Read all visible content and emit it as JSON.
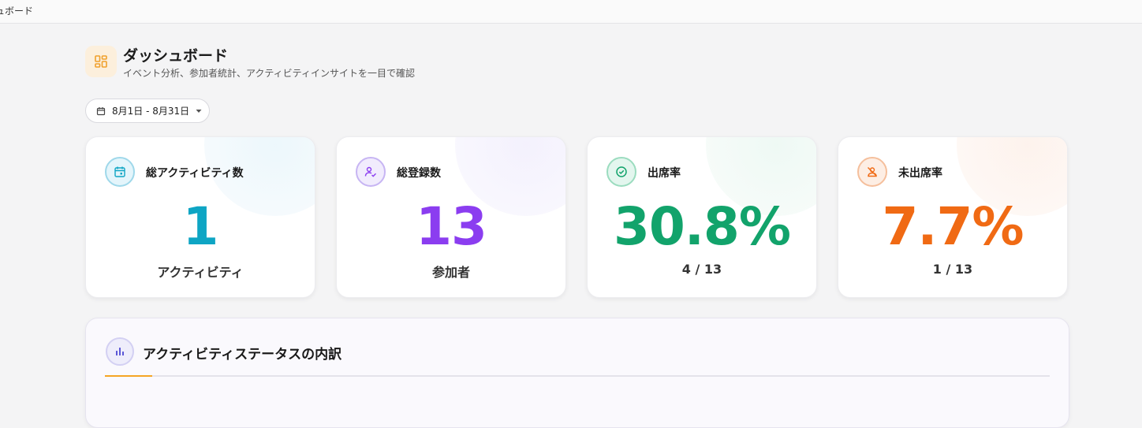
{
  "topbar": {
    "crumb": "ュボード"
  },
  "header": {
    "icon": "dashboard-grid-icon",
    "title": "ダッシュボード",
    "subtitle": "イベント分析、参加者統計、アクティビティインサイトを一目で確認"
  },
  "date_filter": {
    "label": "8月1日 - 8月31日",
    "icon": "calendar-icon"
  },
  "cards": [
    {
      "title": "総アクティビティ数",
      "value": "1",
      "sub": "アクティビティ",
      "icon": "calendar-event-icon",
      "color": "#0ea5c4"
    },
    {
      "title": "総登録数",
      "value": "13",
      "sub": "参加者",
      "icon": "user-check-icon",
      "color": "#8b3df0"
    },
    {
      "title": "出席率",
      "value": "30.8%",
      "sub": "4 / 13",
      "icon": "check-circle-icon",
      "color": "#12a36b"
    },
    {
      "title": "未出席率",
      "value": "7.7%",
      "sub": "1 / 13",
      "icon": "user-off-icon",
      "color": "#f06a14"
    }
  ],
  "status_panel": {
    "title": "アクティビティステータスの内訳",
    "icon": "bar-chart-icon"
  }
}
